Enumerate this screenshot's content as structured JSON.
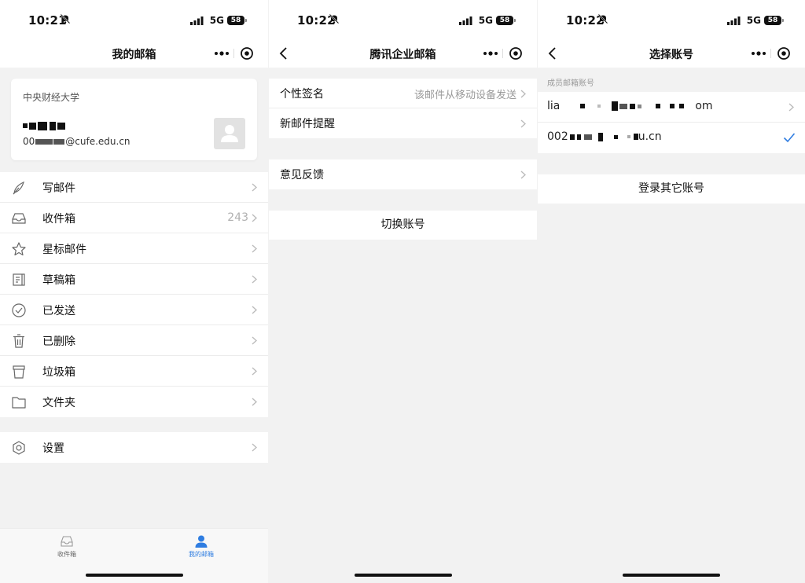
{
  "status_bars": [
    {
      "time": "10:21",
      "network": "5G",
      "battery": "58"
    },
    {
      "time": "10:22",
      "network": "5G",
      "battery": "58"
    },
    {
      "time": "10:22",
      "network": "5G",
      "battery": "58"
    }
  ],
  "my_mailbox": {
    "title": "我的邮箱",
    "account": {
      "organization": "中央财经大学",
      "name_fragment": "",
      "email_fragment": "00",
      "email_suffix": "@cufe.edu.cn"
    },
    "folders": [
      {
        "icon": "pen-icon",
        "label": "写邮件",
        "count": ""
      },
      {
        "icon": "inbox-icon",
        "label": "收件箱",
        "count": "243"
      },
      {
        "icon": "star-icon",
        "label": "星标邮件",
        "count": ""
      },
      {
        "icon": "draft-icon",
        "label": "草稿箱",
        "count": ""
      },
      {
        "icon": "sent-check-icon",
        "label": "已发送",
        "count": ""
      },
      {
        "icon": "trash-icon",
        "label": "已删除",
        "count": ""
      },
      {
        "icon": "junk-bin-icon",
        "label": "垃圾箱",
        "count": ""
      },
      {
        "icon": "folder-icon",
        "label": "文件夹",
        "count": ""
      }
    ],
    "settings_label": "设置",
    "tabs": [
      {
        "label": "收件箱",
        "active": false
      },
      {
        "label": "我的邮箱",
        "active": true
      }
    ]
  },
  "tencent_settings": {
    "title": "腾讯企业邮箱",
    "signature_label": "个性签名",
    "signature_value": "该邮件从移动设备发送",
    "new_mail_alert_label": "新邮件提醒",
    "feedback_label": "意见反馈",
    "switch_account_label": "切换账号"
  },
  "choose_account": {
    "title": "选择账号",
    "section_title": "成员邮箱账号",
    "accounts": [
      {
        "prefix": "lia",
        "suffix": "om",
        "selected": false
      },
      {
        "prefix": "002",
        "suffix": "u.cn",
        "selected": true
      }
    ],
    "login_other_label": "登录其它账号"
  },
  "colors": {
    "accent": "#2f7de1",
    "background": "#f2f2f2",
    "card": "#ffffff",
    "secondary_text": "#999999"
  }
}
